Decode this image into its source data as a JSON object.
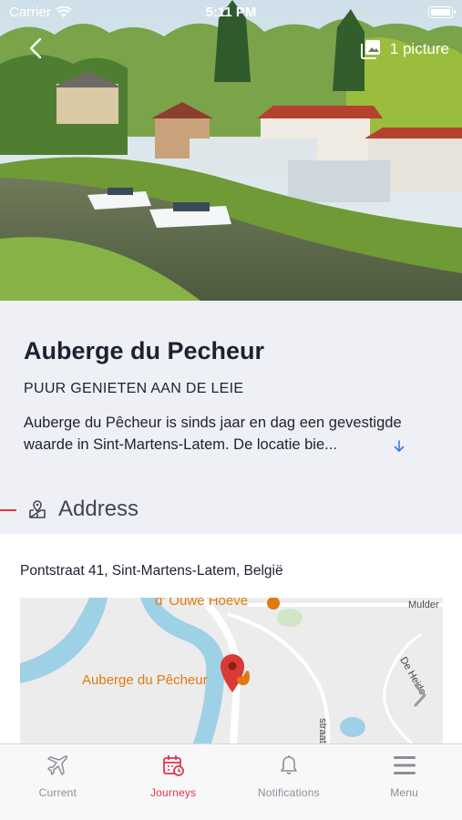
{
  "status_bar": {
    "carrier": "Carrier",
    "time": "5:11 PM"
  },
  "hero": {
    "pictures_label": "1 picture",
    "icons": [
      "back-arrow-icon",
      "gallery-icon"
    ]
  },
  "place": {
    "title": "Auberge du Pecheur",
    "subtitle": "PUUR GENIETEN AAN DE LEIE",
    "description_line1": "Auberge du Pêcheur is sinds jaar en dag een gevestigde",
    "description_line2": "waarde in Sint-Martens-Latem. De locatie bie..."
  },
  "address_section": {
    "title": "Address",
    "address": "Pontstraat 41, Sint-Martens-Latem, België"
  },
  "map": {
    "poi_label": "Auberge du Pêcheur",
    "poi_top_label": "d' Ouwe Hoeve",
    "road_labels": [
      "Mulder",
      "De Heide",
      "straat"
    ]
  },
  "tabs": [
    {
      "label": "Current",
      "icon": "airplane-icon",
      "active": false
    },
    {
      "label": "Journeys",
      "icon": "calendar-icon",
      "active": true
    },
    {
      "label": "Notifications",
      "icon": "bell-icon",
      "active": false
    },
    {
      "label": "Menu",
      "icon": "hamburger-icon",
      "active": false
    }
  ],
  "colors": {
    "accent": "#e8334a",
    "info_background": "#eef0f5",
    "map_water": "#9fd1e6",
    "map_poi": "#e07a10"
  }
}
